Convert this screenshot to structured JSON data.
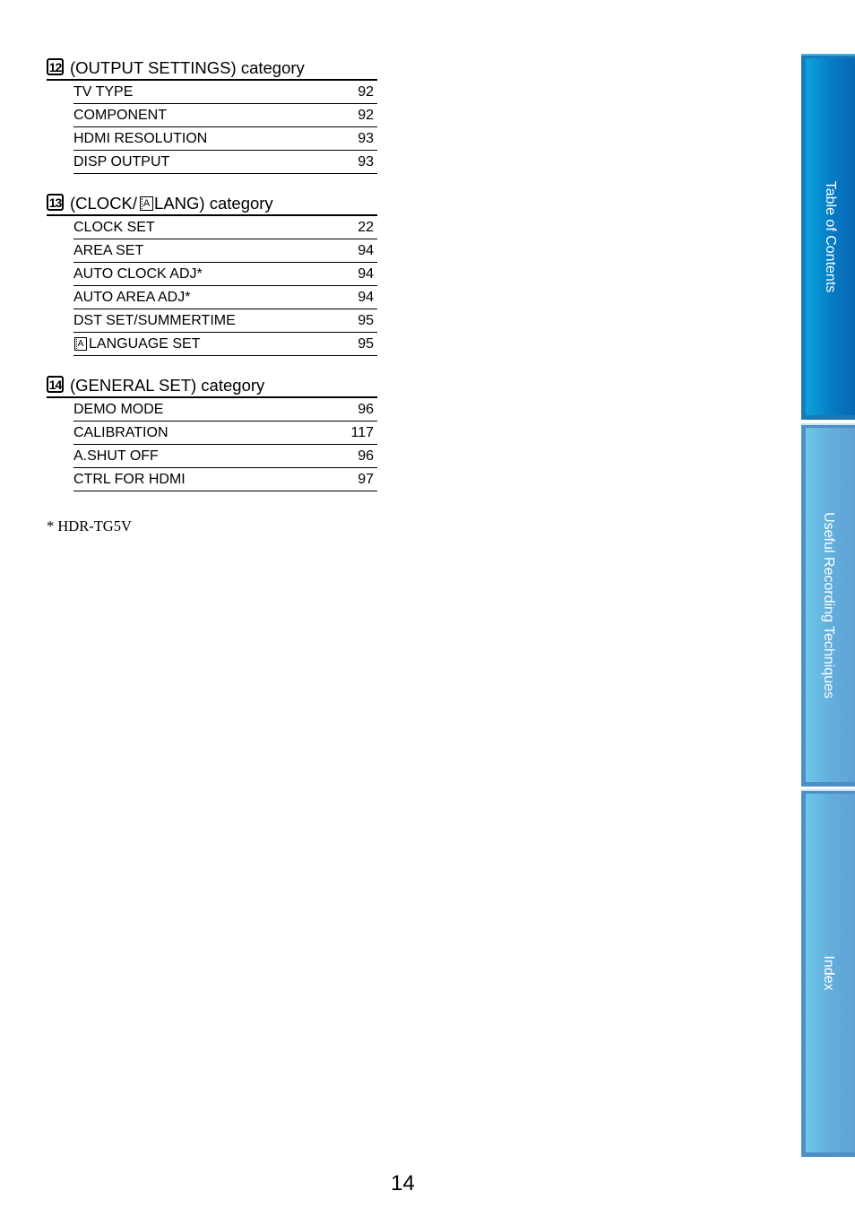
{
  "sections": [
    {
      "number": "12",
      "title": "(OUTPUT SETTINGS) category",
      "rows": [
        {
          "label": "TV TYPE",
          "page": "92"
        },
        {
          "label": "COMPONENT",
          "page": "92"
        },
        {
          "label": "HDMI RESOLUTION",
          "page": "93"
        },
        {
          "label": "DISP OUTPUT",
          "page": "93"
        }
      ]
    },
    {
      "number": "13",
      "title_before_icon": "(CLOCK/",
      "title_icon": "language-icon",
      "title_after_icon": "LANG) category",
      "rows": [
        {
          "label": "CLOCK SET",
          "page": "22"
        },
        {
          "label": "AREA SET",
          "page": "94"
        },
        {
          "label": "AUTO CLOCK ADJ*",
          "page": "94"
        },
        {
          "label": "AUTO AREA ADJ*",
          "page": "94"
        },
        {
          "label": "DST SET/SUMMERTIME",
          "page": "95"
        },
        {
          "label": "LANGUAGE SET",
          "page": "95",
          "icon": "language-icon"
        }
      ]
    },
    {
      "number": "14",
      "title": "(GENERAL SET) category",
      "rows": [
        {
          "label": "DEMO MODE",
          "page": "96"
        },
        {
          "label": "CALIBRATION",
          "page": "117"
        },
        {
          "label": "A.SHUT OFF",
          "page": "96"
        },
        {
          "label": "CTRL FOR HDMI",
          "page": "97"
        }
      ]
    }
  ],
  "language_icon_glyph": "A",
  "footnote": "*  HDR-TG5V",
  "page_number": "14",
  "sidebar": {
    "tabs": [
      {
        "label": "Table of Contents",
        "active": true,
        "color": "#0779c3"
      },
      {
        "label": "Useful Recording Techniques",
        "active": false,
        "color": "#63aedc"
      },
      {
        "label": "Index",
        "active": false,
        "color": "#63aedc"
      }
    ]
  }
}
